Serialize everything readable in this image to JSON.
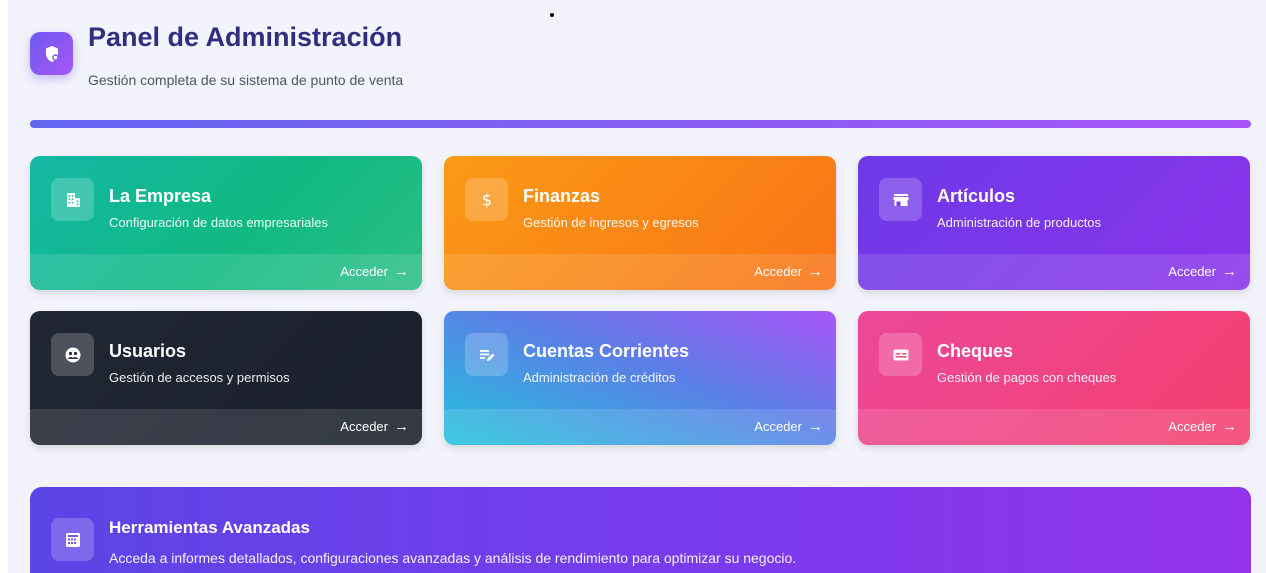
{
  "header": {
    "title": "Panel de Administración",
    "subtitle": "Gestión completa de su sistema de punto de venta",
    "logo_icon": "shield-icon"
  },
  "cards": [
    {
      "title": "La Empresa",
      "description": "Configuración de datos empresariales",
      "action": "Acceder",
      "icon": "building-icon",
      "color": "#10b981"
    },
    {
      "title": "Finanzas",
      "description": "Gestión de ingresos y egresos",
      "action": "Acceder",
      "icon": "dollar-icon",
      "color": "#f97316"
    },
    {
      "title": "Artículos",
      "description": "Administración de productos",
      "action": "Acceder",
      "icon": "store-icon",
      "color": "#7c3aed"
    },
    {
      "title": "Usuarios",
      "description": "Gestión de accesos y permisos",
      "action": "Acceder",
      "icon": "users-icon",
      "color": "#1f2937"
    },
    {
      "title": "Cuentas Corrientes",
      "description": "Administración de créditos",
      "action": "Acceder",
      "icon": "edit-list-icon",
      "color": "#5b7fe6"
    },
    {
      "title": "Cheques",
      "description": "Gestión de pagos con cheques",
      "action": "Acceder",
      "icon": "check-card-icon",
      "color": "#f43f6e"
    }
  ],
  "advanced": {
    "title": "Herramientas Avanzadas",
    "description": "Acceda a informes detallados, configuraciones avanzadas y análisis de rendimiento para optimizar su negocio.",
    "icon": "dashboard-icon"
  },
  "arrow_glyph": "→"
}
